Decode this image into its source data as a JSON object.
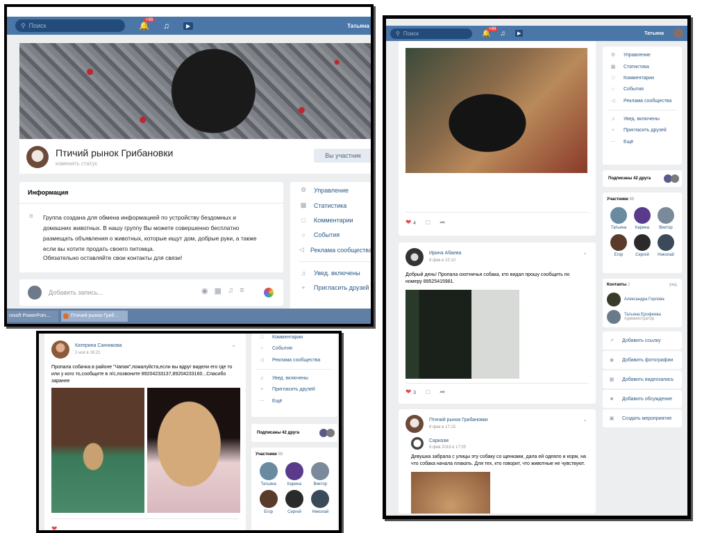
{
  "panel_top_left": {
    "search_placeholder": "Поиск",
    "notifications_badge": "+99",
    "user_name": "Татьяна",
    "group_name": "Птичий рынок Грибановки",
    "status_link": "изменить статус",
    "member_button": "Вы участник",
    "info_title": "Информация",
    "info_text": "Группа создана для обмена информацией по устройству бездомных и домашних животных. В нашу группу Вы можете совершенно бесплатно размещать объявления о животных, которые ищут дом, добрые руки, а также если вы хотите продать своего питомца.",
    "info_text2": "Обязательно оставляйте свои контакты для связи!",
    "composer_placeholder": "Добавить запись...",
    "menu": [
      "Управление",
      "Статистика",
      "Комментарии",
      "События",
      "Реклама сообщества",
      "Увед. включены",
      "Пригласить друзей"
    ],
    "taskbar": [
      "rosoft PowerPoin...",
      "Птичий рынок Гриб..."
    ]
  },
  "panel_right": {
    "search_placeholder": "Поиск",
    "notifications_badge": "+99",
    "user_name": "Татьяна",
    "post1": {
      "likes": "4"
    },
    "post2": {
      "author": "Ирина Абаева",
      "date": "8 фев в 22:10",
      "text": "Добрый день! Пропала охотничья собака, кто видал прошу сообщить по номеру 89525415981.",
      "likes": "3"
    },
    "post3": {
      "author": "Птичий рынок Грибановки",
      "date": "8 фев в 17:15",
      "repost_author": "Сарказм",
      "repost_date": "8 фев 2018 в 17:05",
      "text": "Девушка забрала с улицы эту собаку со щенками, дала ей одеяло и корм, на что собака начала плакать. Для тех, кто говорит, что животные не чувствуют."
    },
    "menu": [
      "Управление",
      "Статистика",
      "Комментарии",
      "События",
      "Реклама сообщества",
      "Увед. включены",
      "Пригласить друзей",
      "Ещё"
    ],
    "friends_subscribed": "Подписаны 42 друга",
    "members_title": "Участники",
    "members_count": "88",
    "members": [
      "Татьяна",
      "Карина",
      "Виктор",
      "Егор",
      "Сергей",
      "Николай"
    ],
    "contacts_title": "Контакты",
    "contacts_count": "2",
    "contacts_edit": "ред.",
    "contacts": [
      {
        "name": "Александра Горлова",
        "role": ""
      },
      {
        "name": "Татьяна Ерофеева",
        "role": "Администратор"
      }
    ],
    "actions": [
      "Добавить ссылку",
      "Добавить фотографии",
      "Добавить видеозапись",
      "Добавить обсуждение",
      "Создать мероприятие"
    ]
  },
  "panel_bottom_left": {
    "post": {
      "author": "Катерина Санникова",
      "date": "2 ноя в 16:21",
      "text": "Пропала собачка в районе \"Чапая\",пожалуйста,если вы вдруг видели его где то или у кого то,сообщите в л/с,позвоните 89204233137,89204233160...Спасибо заранее"
    },
    "menu": [
      "Комментарии",
      "События",
      "Реклама сообщества",
      "Увед. включены",
      "Пригласить друзей",
      "Ещё"
    ],
    "friends_subscribed": "Подписаны 42 друга",
    "members_title": "Участники",
    "members_count": "88",
    "members": [
      "Татьяна",
      "Карина",
      "Виктор",
      "Егор",
      "Сергей",
      "Николай"
    ]
  },
  "colors": {
    "vk_blue": "#4a76a8",
    "link": "#2a5885",
    "like": "#e64646"
  }
}
